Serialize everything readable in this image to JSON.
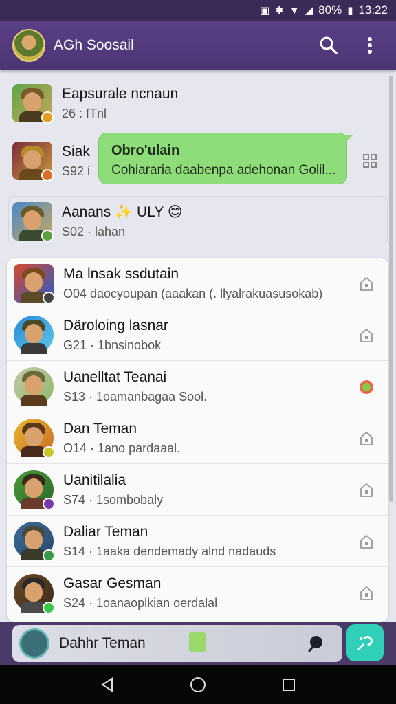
{
  "status_bar": {
    "battery": "80%",
    "time": "13:22"
  },
  "app_bar": {
    "title": "AGh Soosail"
  },
  "top_chats": [
    {
      "name": "Eapsurale ncnaun",
      "sub": "26 : fTnl"
    },
    {
      "name": "Siak",
      "sub": "S92 i"
    },
    {
      "name": "Aanans ✨ ULY 😊",
      "sub": "S02 · lahan"
    }
  ],
  "bubble": {
    "title": "Obro'ulain",
    "text": "Cohiararia daabenpa adehonan Golil..."
  },
  "list": [
    {
      "name": "Ma lnsak ssdutain",
      "sub": "O04 daocyoupan (aaakan (. llyalrakuasusokab)"
    },
    {
      "name": "Däroloing lasnar",
      "sub": "G21 · 1bnsinobok"
    },
    {
      "name": "Uanelltat Teanai",
      "sub": "S13 · 1oamanbagaa Sool."
    },
    {
      "name": "Dan Teman",
      "sub": "O14 · 1ano pardaaal."
    },
    {
      "name": "Uanitilalia",
      "sub": "S74 · 1sombobaly"
    },
    {
      "name": "Daliar Teman",
      "sub": "S14 · 1aaka dendemady alnd nadauds"
    },
    {
      "name": "Gasar Gesman",
      "sub": "S24 · 1oanaoplkian oerdalal"
    }
  ],
  "bottom": {
    "label": "Dahhr Teman"
  },
  "colors": {
    "primary": "#4d3574",
    "bubble": "#8fdc7a",
    "fab": "#2fcfb8"
  }
}
